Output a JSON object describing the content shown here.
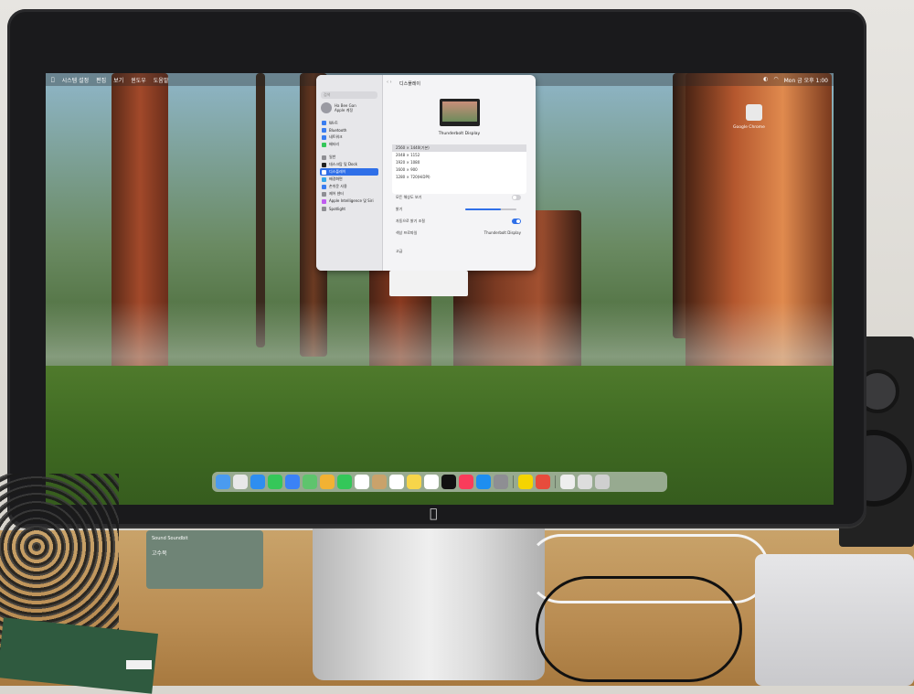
{
  "menubar": {
    "left": [
      "시스템 설정",
      "편집",
      "보기",
      "윈도우",
      "도움말"
    ],
    "right": [
      "Mon 금 오후 1:00"
    ]
  },
  "settings": {
    "search_placeholder": "검색",
    "user": {
      "name": "Ha Bee Gan",
      "sub": "Apple 계정"
    },
    "sidebar_items": [
      {
        "label": "Wi-Fi"
      },
      {
        "label": "Bluetooth"
      },
      {
        "label": "네트워크"
      },
      {
        "label": "배터리"
      },
      {
        "label": "일반"
      },
      {
        "label": "데스크탑 및 Dock"
      },
      {
        "label": "디스플레이",
        "selected": true
      },
      {
        "label": "배경화면"
      },
      {
        "label": "손쉬운 사용"
      },
      {
        "label": "제어 센터"
      },
      {
        "label": "Apple Intelligence 및 Siri"
      },
      {
        "label": "Spotlight"
      }
    ],
    "title": "디스플레이",
    "display_name": "Thunderbolt Display",
    "resolutions": [
      {
        "label": "2560 × 1440(기본)",
        "selected": true
      },
      {
        "label": "2048 × 1152"
      },
      {
        "label": "1920 × 1080"
      },
      {
        "label": "1600 × 900"
      },
      {
        "label": "1280 × 720(HiDPI)"
      }
    ],
    "show_all": "모든 해상도 보기",
    "brightness_label": "밝기",
    "brightness_level": 0.7,
    "auto_brightness_label": "자동으로 밝기 조절",
    "color_profile_label": "색상 프로파일",
    "color_profile_value": "Thunderbolt Display",
    "advanced_label": "고급"
  },
  "desktop_app": {
    "label": "Google Chrome"
  },
  "dock_icons": [
    "finder-icon",
    "launchpad-icon",
    "safari-icon",
    "messages-icon",
    "mail-icon",
    "maps-icon",
    "photos-icon",
    "facetime-icon",
    "calendar-icon",
    "contacts-icon",
    "reminders-icon",
    "notes-icon",
    "freeform-icon",
    "tv-icon",
    "music-icon",
    "app-store-icon",
    "settings-icon",
    "kakaotalk-icon",
    "chrome-icon",
    "preview-icon",
    "image-icon",
    "trash-icon"
  ],
  "dock_colors": [
    "#4a9bf0",
    "#e8e8e8",
    "#2e8ef0",
    "#35c759",
    "#3b82f6",
    "#5ec46d",
    "#f2b233",
    "#34c759",
    "#ffffff",
    "#c9a26b",
    "#ffffff",
    "#f6d54a",
    "#ffffff",
    "#111111",
    "#fa3c5b",
    "#1e8ef0",
    "#8e8e93",
    "#f5d400",
    "#e74c3c",
    "#eeeeee",
    "#dddddd",
    "#cfcfcf"
  ],
  "popup": {
    "line1": "",
    "line2": ""
  },
  "box": {
    "brand": "Sound Soundbit",
    "label": "고수북"
  },
  "sticker": {
    "text": ""
  }
}
